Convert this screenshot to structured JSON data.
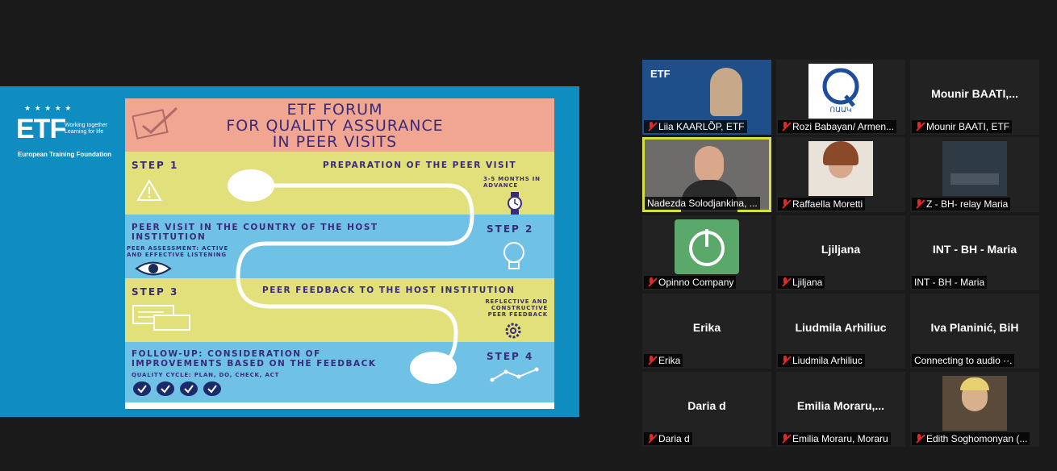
{
  "share": {
    "etf_logo": {
      "stars": "★ ★ ★ ★ ★",
      "name_big": "ETF",
      "tagline": "Working together Learning for life",
      "org": "European Training Foundation"
    },
    "poster": {
      "title_lines": [
        "ETF FORUM",
        "FOR QUALITY ASSURANCE",
        "IN PEER VISITS"
      ],
      "step1": {
        "head": "STEP 1",
        "text": "PREPARATION OF THE PEER VISIT",
        "sub": "3-5 MONTHS IN ADVANCE"
      },
      "step2": {
        "head": "STEP 2",
        "text": "PEER VISIT IN THE COUNTRY OF THE HOST INSTITUTION",
        "sub": "PEER ASSESSMENT: ACTIVE AND EFFECTIVE LISTENING"
      },
      "step3": {
        "head": "STEP 3",
        "text": "PEER FEEDBACK TO THE HOST INSTITUTION",
        "sub": "REFLECTIVE AND CONSTRUCTIVE PEER FEEDBACK"
      },
      "step4": {
        "head": "STEP 4",
        "text": "FOLLOW-UP: CONSIDERATION OF IMPROVEMENTS BASED ON THE FEEDBACK",
        "sub": "QUALITY CYCLE: PLAN, DO, CHECK, ACT"
      },
      "colors": {
        "pink": "#f0a690",
        "yellow": "#e2e07a",
        "blue": "#6fc2e6",
        "navy": "#3b2a7a"
      }
    }
  },
  "participants": [
    {
      "label": "Liia KAARLÕP, ETF",
      "muted": true,
      "video": "etf-woman"
    },
    {
      "label": "Rozi Babayan/ Armen...",
      "muted": true,
      "video": "q-logo",
      "logo_text": "ՈԱԱԿ"
    },
    {
      "label": "Mounir BAATI, ETF",
      "muted": true,
      "center": "Mounir  BAATI,..."
    },
    {
      "label": "Nadezda Solodjankina, ...",
      "muted": false,
      "video": "webcam",
      "active": true
    },
    {
      "label": "Raffaella Moretti",
      "muted": true,
      "video": "portrait"
    },
    {
      "label": "Z - BH- relay Maria",
      "muted": true,
      "video": "room"
    },
    {
      "label": "Opinno Company",
      "muted": true,
      "video": "green-logo"
    },
    {
      "label": "Ljiljana",
      "muted": true,
      "center": "Ljiljana"
    },
    {
      "label": "INT - BH - Maria",
      "muted": false,
      "center": "INT - BH - Maria"
    },
    {
      "label": "Erika",
      "muted": true,
      "center": "Erika"
    },
    {
      "label": "Liudmila Arhiliuc",
      "muted": true,
      "center": "Liudmila Arhiliuc"
    },
    {
      "label": "Connecting to audio ··.",
      "muted": false,
      "center": "Iva Planinić, BiH"
    },
    {
      "label": "Daria d",
      "muted": true,
      "center": "Daria d"
    },
    {
      "label": "Emilia Moraru, Moraru",
      "muted": true,
      "center": "Emilia  Moraru,..."
    },
    {
      "label": "Edith Soghomonyan (...",
      "muted": true,
      "video": "photo"
    }
  ]
}
